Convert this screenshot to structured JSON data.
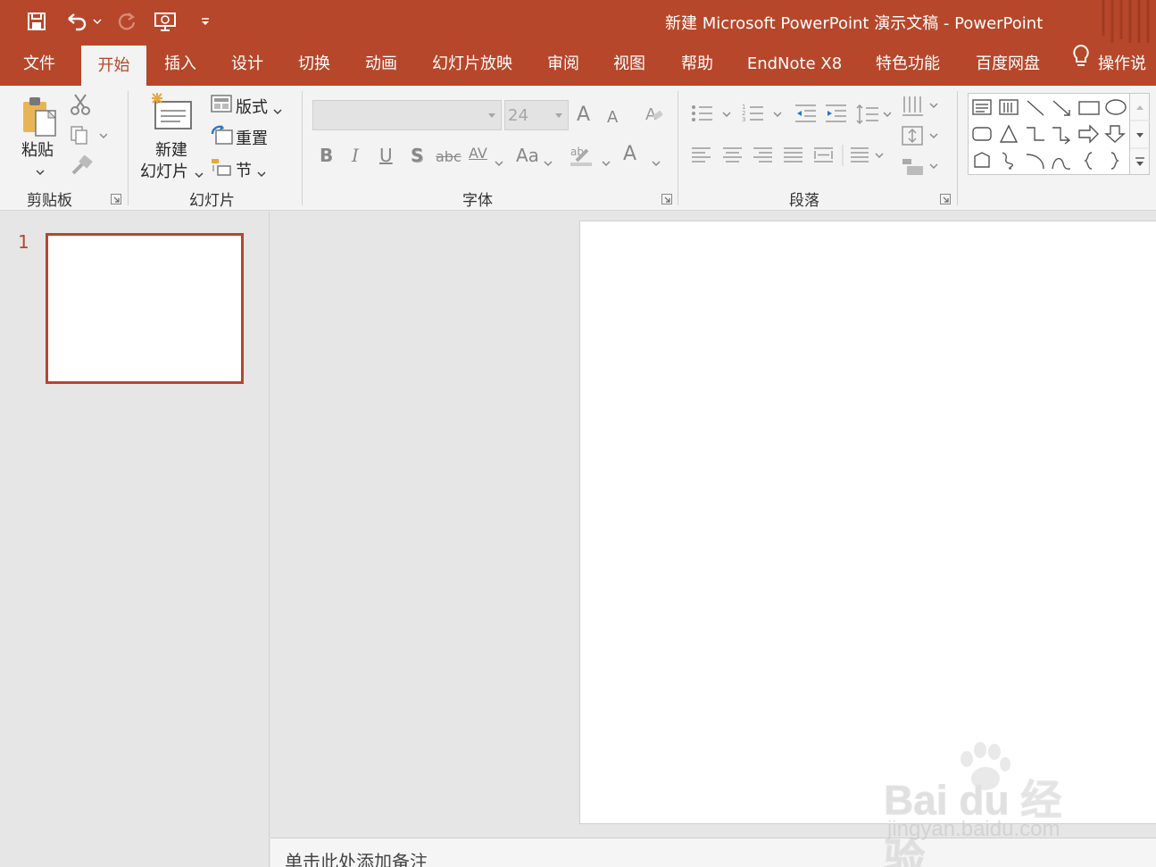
{
  "titlebar": {
    "title": "新建 Microsoft PowerPoint 演示文稿  -  PowerPoint",
    "bg_color": "#b7472a"
  },
  "qat": {
    "save_icon": "save-icon",
    "undo_icon": "undo-icon",
    "redo_icon": "redo-icon",
    "start_slideshow_icon": "present-from-beginning-icon",
    "customize_icon": "customize-qat-icon"
  },
  "tabs": [
    {
      "label": "文件"
    },
    {
      "label": "开始",
      "active": true
    },
    {
      "label": "插入"
    },
    {
      "label": "设计"
    },
    {
      "label": "切换"
    },
    {
      "label": "动画"
    },
    {
      "label": "幻灯片放映"
    },
    {
      "label": "审阅"
    },
    {
      "label": "视图"
    },
    {
      "label": "帮助"
    },
    {
      "label": "EndNote X8"
    },
    {
      "label": "特色功能"
    },
    {
      "label": "百度网盘"
    },
    {
      "label": "操作说"
    }
  ],
  "ribbon": {
    "clipboard": {
      "label": "剪贴板",
      "paste": "粘贴"
    },
    "slides": {
      "label": "幻灯片",
      "new_slide_line1": "新建",
      "new_slide_line2": "幻灯片",
      "layout": "版式",
      "reset": "重置",
      "section": "节"
    },
    "font": {
      "label": "字体",
      "font_name": "",
      "font_size": "24",
      "grow": "A",
      "shrink": "A",
      "bold": "B",
      "italic": "I",
      "underline": "U",
      "shadow": "S",
      "strike": "abc",
      "spacing": "AV",
      "case": "Aa",
      "color": "A"
    },
    "paragraph": {
      "label": "段落"
    }
  },
  "slides_pane": {
    "slide_number": "1"
  },
  "notes": {
    "placeholder": "单击此处添加备注"
  },
  "watermark": {
    "brand": "Bai du 经验",
    "url": "jingyan.baidu.com"
  }
}
